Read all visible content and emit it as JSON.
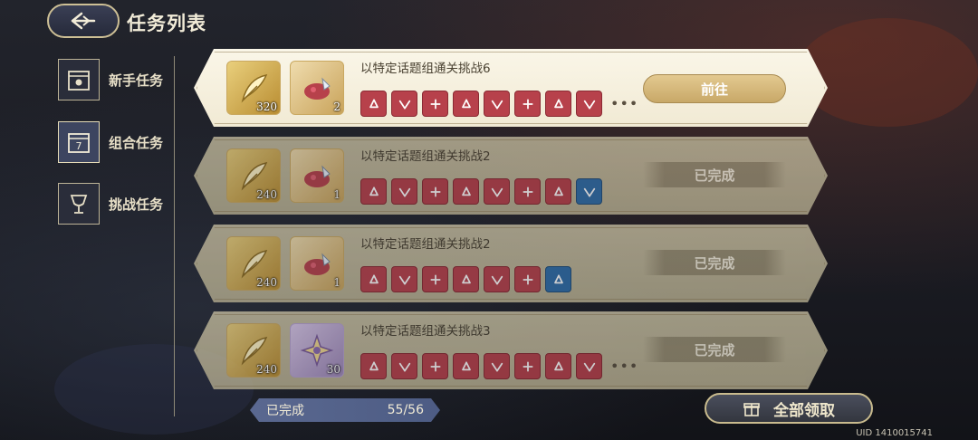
{
  "header": {
    "title": "任务列表"
  },
  "sidebar": {
    "items": [
      {
        "label": "新手任务",
        "icon": "calendar-sun-icon",
        "active": false
      },
      {
        "label": "组合任务",
        "icon": "calendar-seven-icon",
        "active": true
      },
      {
        "label": "挑战任务",
        "icon": "trophy-cup-icon",
        "active": false
      }
    ]
  },
  "tasks": [
    {
      "title": "以特定话题组通关挑战6",
      "rewards": [
        {
          "type": "gold",
          "count": "320"
        },
        {
          "type": "red",
          "count": "2"
        }
      ],
      "conditions": [
        "red",
        "red",
        "red",
        "red",
        "red",
        "red",
        "red",
        "red"
      ],
      "more": "•••",
      "status": "go",
      "action_label": "前往"
    },
    {
      "title": "以特定话题组通关挑战2",
      "rewards": [
        {
          "type": "gold",
          "count": "240"
        },
        {
          "type": "red",
          "count": "1"
        }
      ],
      "conditions": [
        "red",
        "red",
        "red",
        "red",
        "red",
        "red",
        "red",
        "blue"
      ],
      "more": "",
      "status": "done",
      "action_label": "已完成"
    },
    {
      "title": "以特定话题组通关挑战2",
      "rewards": [
        {
          "type": "gold",
          "count": "240"
        },
        {
          "type": "red",
          "count": "1"
        }
      ],
      "conditions": [
        "red",
        "red",
        "red",
        "red",
        "red",
        "red",
        "blue"
      ],
      "more": "",
      "status": "done",
      "action_label": "已完成"
    },
    {
      "title": "以特定话题组通关挑战3",
      "rewards": [
        {
          "type": "gold",
          "count": "240"
        },
        {
          "type": "purple",
          "count": "30"
        }
      ],
      "conditions": [
        "red",
        "red",
        "red",
        "red",
        "red",
        "red",
        "red",
        "red"
      ],
      "more": "•••",
      "status": "done",
      "action_label": "已完成"
    }
  ],
  "footer": {
    "progress_label": "已完成",
    "progress_value": "55/56",
    "claim_all_label": "全部领取",
    "uid": "UID 1410015741"
  },
  "colors": {
    "condition_red": "#b7414b",
    "condition_blue": "#2f6ea8",
    "gold_accent": "#c9a860"
  }
}
